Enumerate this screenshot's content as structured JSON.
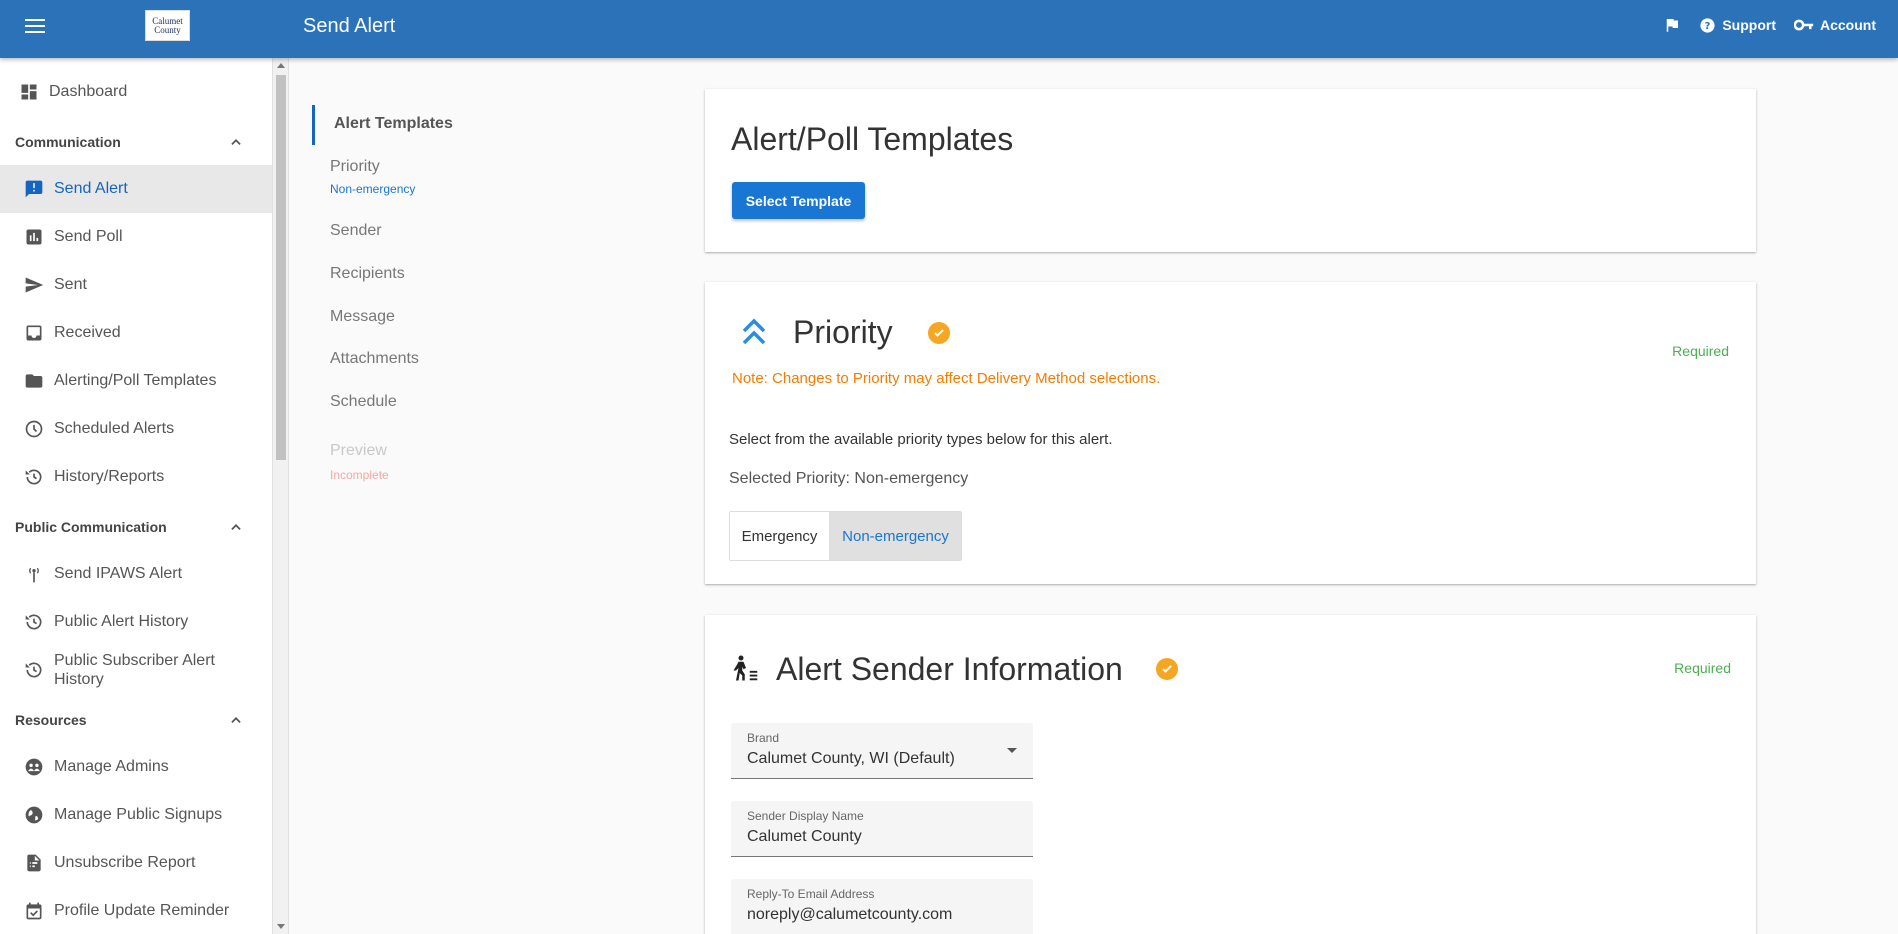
{
  "header": {
    "title": "Send Alert",
    "logo_text_1": "Calumet",
    "logo_text_2": "County",
    "support_label": "Support",
    "account_label": "Account"
  },
  "sidebar": {
    "dashboard": "Dashboard",
    "sections": [
      {
        "title": "Communication",
        "items": [
          "Send Alert",
          "Send Poll",
          "Sent",
          "Received",
          "Alerting/Poll Templates",
          "Scheduled Alerts",
          "History/Reports"
        ]
      },
      {
        "title": "Public Communication",
        "items": [
          "Send IPAWS Alert",
          "Public Alert History",
          "Public Subscriber Alert History"
        ]
      },
      {
        "title": "Resources",
        "items": [
          "Manage Admins",
          "Manage Public Signups",
          "Unsubscribe Report",
          "Profile Update Reminder"
        ]
      }
    ]
  },
  "stepper": {
    "steps": [
      "Alert Templates",
      "Priority",
      "Sender",
      "Recipients",
      "Message",
      "Attachments",
      "Schedule",
      "Preview"
    ],
    "priority_sub": "Non-emergency",
    "preview_sub": "Incomplete"
  },
  "templates_card": {
    "title": "Alert/Poll Templates",
    "button": "Select Template"
  },
  "priority_card": {
    "title": "Priority",
    "required": "Required",
    "note": "Note: Changes to Priority may affect Delivery Method selections.",
    "instruction": "Select from the available priority types below for this alert.",
    "selected": "Selected Priority: Non-emergency",
    "options": [
      "Emergency",
      "Non-emergency"
    ]
  },
  "sender_card": {
    "title": "Alert Sender Information",
    "required": "Required",
    "brand_label": "Brand",
    "brand_value": "Calumet County, WI (Default)",
    "display_name_label": "Sender Display Name",
    "display_name_value": "Calumet County",
    "reply_to_label": "Reply-To Email Address",
    "reply_to_value": "noreply@calumetcounty.com"
  },
  "colors": {
    "header": "#2b72b8",
    "primary": "#1976d2",
    "required": "#4caf50",
    "check": "#f5a623",
    "note": "#f57c00"
  }
}
